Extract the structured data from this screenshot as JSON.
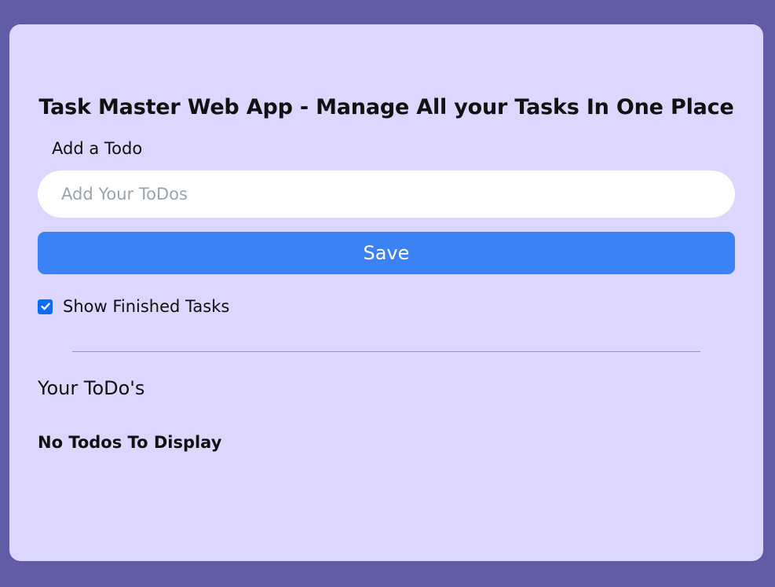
{
  "header": {
    "title": "Task Master Web App - Manage All your Tasks In One Place"
  },
  "add_todo": {
    "label": "Add a Todo",
    "input_value": "",
    "placeholder": "Add Your ToDos",
    "save_label": "Save"
  },
  "filter": {
    "show_finished_label": "Show Finished Tasks",
    "show_finished_checked": true
  },
  "todos": {
    "heading": "Your ToDo's",
    "empty_message": "No Todos To Display",
    "items": []
  },
  "colors": {
    "page_background": "#625ba6",
    "card_background": "#ddd6fe",
    "primary_button": "#3b82f6",
    "checkbox_checked": "#0b6cf5"
  }
}
